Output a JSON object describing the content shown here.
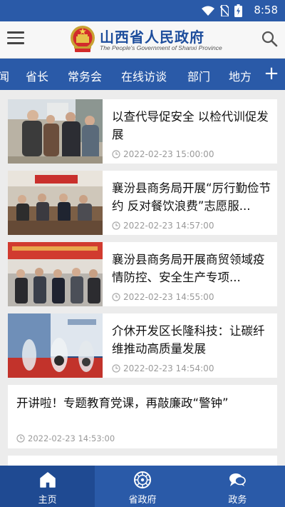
{
  "status_bar": {
    "time": "8:58"
  },
  "header": {
    "logo_title": "山西省人民政府",
    "logo_subtitle": "The People's Government of Shanxi Province",
    "menu_icon": "hamburger-icon",
    "search_icon": "search-icon"
  },
  "tabs": [
    "闻",
    "省长",
    "常务会",
    "在线访谈",
    "部门",
    "地方"
  ],
  "tab_add": "+",
  "news": [
    {
      "title": "以查代导促安全 以检代训促发展",
      "time": "2022-02-23  15:00:00"
    },
    {
      "title": "襄汾县商务局开展“厉行勤俭节约 反对餐饮浪费”志愿服...",
      "time": "2022-02-23  14:57:00"
    },
    {
      "title": "襄汾县商务局开展商贸领域疫情防控、安全生产专项...",
      "time": "2022-02-23  14:55:00"
    },
    {
      "title": "介休开发区长隆科技：让碳纤维推动高质量发展",
      "time": "2022-02-23  14:54:00"
    },
    {
      "title": "开讲啦！专题教育党课，再敲廉政“警钟”",
      "time": "2022-02-23  14:53:00"
    }
  ],
  "bottom_nav": [
    {
      "label": "主页",
      "icon": "home-icon",
      "active": true
    },
    {
      "label": "省政府",
      "icon": "emblem-icon",
      "active": false
    },
    {
      "label": "政务",
      "icon": "chat-icon",
      "active": false
    }
  ],
  "colors": {
    "primary": "#2a5aa8",
    "active_nav": "#1f4a92",
    "background": "#ececec"
  }
}
